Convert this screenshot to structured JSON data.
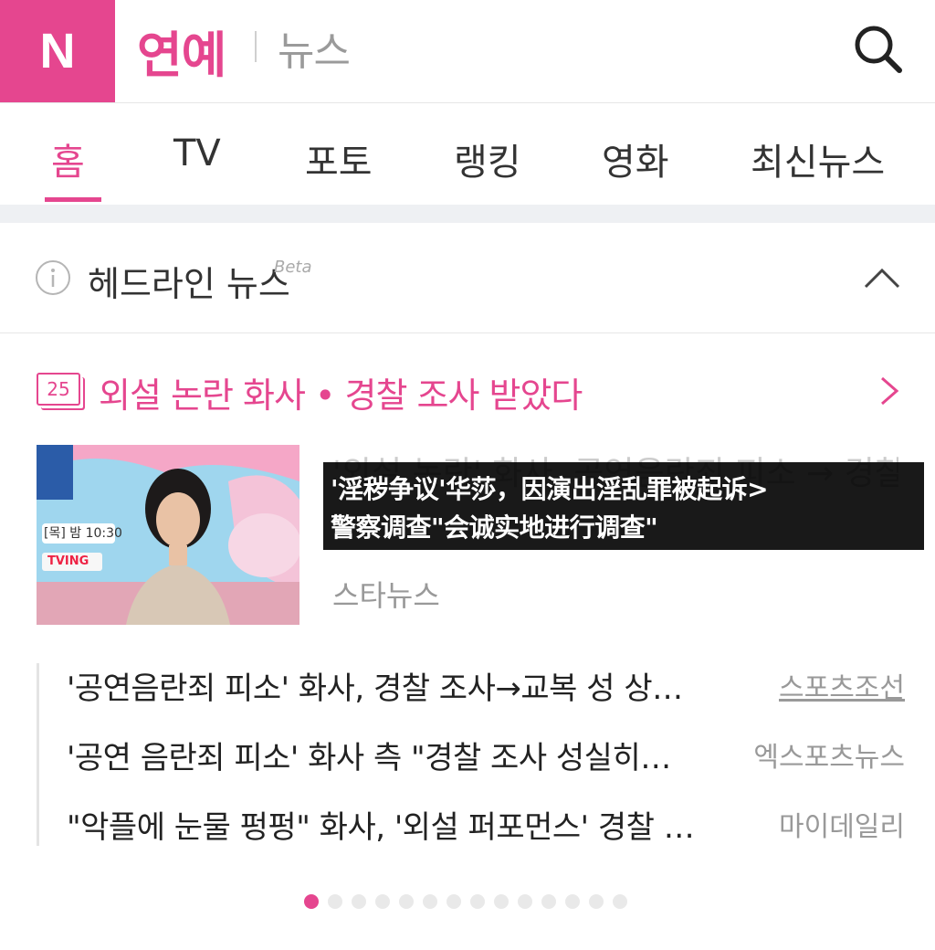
{
  "header": {
    "logo": "N",
    "brand": "연예",
    "sub": "뉴스"
  },
  "tabs": [
    {
      "label": "홈",
      "active": true
    },
    {
      "label": "TV"
    },
    {
      "label": "포토"
    },
    {
      "label": "랭킹"
    },
    {
      "label": "영화"
    },
    {
      "label": "최신뉴스"
    }
  ],
  "headline": {
    "title": "헤드라인 뉴스",
    "beta": "Beta"
  },
  "topic": {
    "count": "25",
    "text": "외설 논란 화사 • 경찰 조사 받았다"
  },
  "featured": {
    "thumb_caption_time": "[목] 밤 10:30",
    "thumb_caption_brand": "TVING",
    "title_ko": "'외설 논란' 화사, 공연음란죄 피소 → 경찰 조사 성실 [종합]",
    "subtitle_line1": "'淫秽争议'华莎，因演出淫乱罪被起诉>",
    "subtitle_line2": "警察调查\"会诚实地进行调查\"",
    "source": "스타뉴스"
  },
  "related": [
    {
      "title": "'공연음란죄 피소' 화사, 경찰 조사→교복 성 상…",
      "source": "스포츠조선"
    },
    {
      "title": "'공연 음란죄 피소' 화사 측 \"경찰 조사 성실히…",
      "source": "엑스포츠뉴스"
    },
    {
      "title": "\"악플에 눈물 펑펑\" 화사, '외설 퍼포먼스' 경찰 …",
      "source": "마이데일리"
    }
  ],
  "pagination": {
    "total": 14,
    "current": 1
  },
  "colors": {
    "accent": "#e5468f",
    "muted": "#999999"
  },
  "icons": {
    "search": "search-icon",
    "info": "info-icon",
    "collapse": "chevron-up-icon",
    "topic": "chevron-right-icon"
  }
}
